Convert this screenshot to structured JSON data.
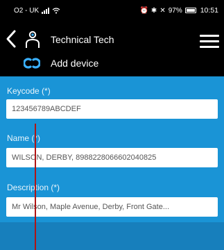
{
  "status_bar": {
    "carrier": "O2 - UK",
    "battery": "97%",
    "time": "10:51"
  },
  "header": {
    "title": "Technical Tech",
    "subtitle": "Add device"
  },
  "form": {
    "keycode_label": "Keycode (*)",
    "keycode_value": "123456789ABCDEF",
    "name_label": "Name (*)",
    "name_value": "WILSON, DERBY, 8988228066602040825",
    "description_label": "Description (*)",
    "description_value": "Mr Wilson, Maple Avenue, Derby, Front Gate..."
  },
  "colors": {
    "header_bg": "#000000",
    "form_bg": "#1a94d6",
    "bottom_bg": "#177fbc",
    "accent_icon": "#3ab0ff"
  },
  "icons": [
    "back-arrow-icon",
    "user-icon",
    "menu-icon",
    "link-icon",
    "signal-icon",
    "wifi-icon",
    "battery-icon"
  ]
}
